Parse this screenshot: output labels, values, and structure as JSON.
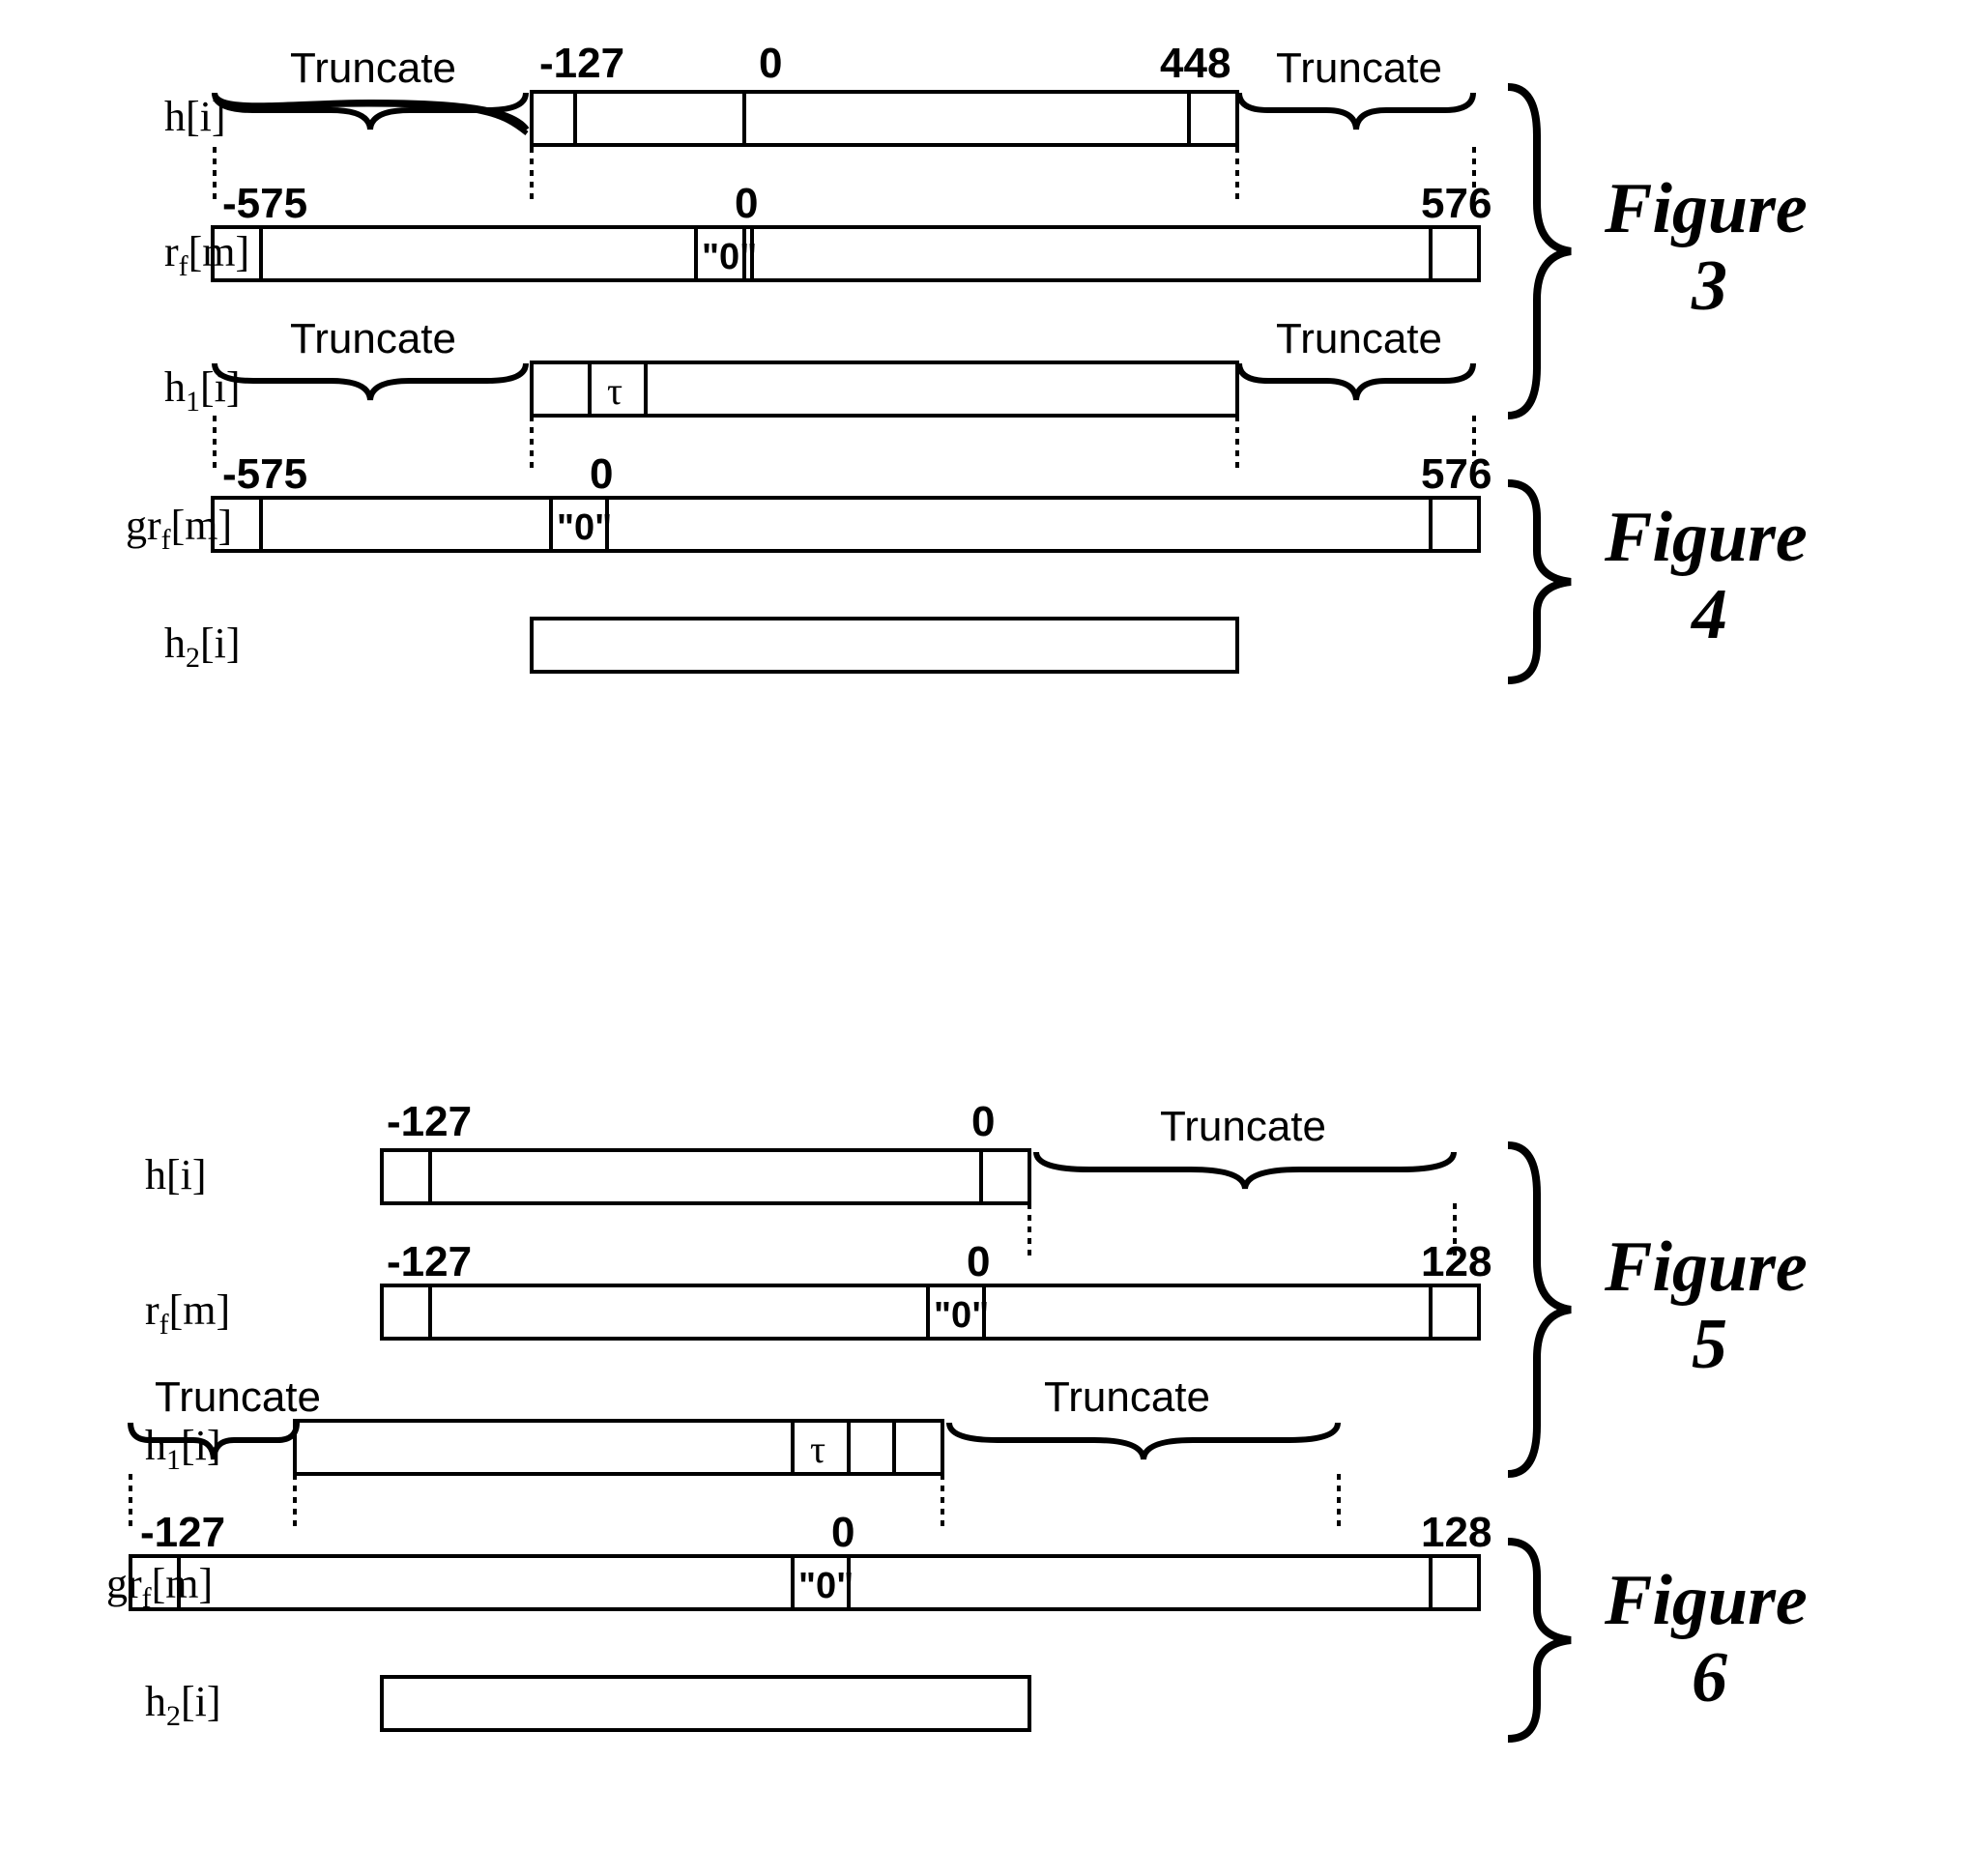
{
  "fig3": {
    "label": "Figure 3",
    "rows": {
      "h": {
        "name": "h[i]",
        "ticks": {
          "start": "-127",
          "zero": "0",
          "end": "448"
        },
        "truncLeft": "Truncate",
        "truncRight": "Truncate"
      },
      "rf": {
        "name": "r",
        "sub": "f",
        "arg": "[m]",
        "ticks": {
          "start": "-575",
          "zero": "0",
          "end": "576"
        },
        "zeroCell": "\"0\""
      },
      "h1": {
        "name": "h",
        "sub": "1",
        "arg": "[i]",
        "tau": "τ",
        "truncLeft": "Truncate",
        "truncRight": "Truncate"
      }
    }
  },
  "fig4": {
    "label": "Figure 4",
    "rows": {
      "grf": {
        "name": "gr",
        "sub": "f",
        "arg": "[m]",
        "ticks": {
          "start": "-575",
          "zero": "0",
          "end": "576"
        },
        "zeroCell": "\"0\""
      },
      "h2": {
        "name": "h",
        "sub": "2",
        "arg": "[i]"
      }
    }
  },
  "fig5": {
    "label": "Figure 5",
    "rows": {
      "h": {
        "name": "h[i]",
        "ticks": {
          "start": "-127",
          "zero": "0"
        },
        "truncRight": "Truncate"
      },
      "rf": {
        "name": "r",
        "sub": "f",
        "arg": "[m]",
        "ticks": {
          "start": "-127",
          "zero": "0",
          "end": "128"
        },
        "zeroCell": "\"0\""
      },
      "h1": {
        "name": "h",
        "sub": "1",
        "arg": "[i]",
        "tau": "τ",
        "truncLeft": "Truncate",
        "truncRight": "Truncate"
      }
    }
  },
  "fig6": {
    "label": "Figure 6",
    "rows": {
      "grf": {
        "name": "gr",
        "sub": "f",
        "arg": "[m]",
        "ticks": {
          "start": "-127",
          "zero": "0",
          "end": "128"
        },
        "zeroCell": "\"0\""
      },
      "h2": {
        "name": "h",
        "sub": "2",
        "arg": "[i]"
      }
    }
  },
  "chart_data": [
    {
      "type": "bar",
      "figure": "3",
      "series": "h[i]",
      "range": [
        -127,
        448
      ],
      "zero_marker": 0,
      "truncated": [
        "left",
        "right"
      ]
    },
    {
      "type": "bar",
      "figure": "3",
      "series": "r_f[m]",
      "range": [
        -575,
        576
      ],
      "zero_marker": 0,
      "center_value": "0"
    },
    {
      "type": "bar",
      "figure": "3",
      "series": "h_1[i]",
      "range": [
        -127,
        448
      ],
      "center_value": "τ",
      "truncated": [
        "left",
        "right"
      ]
    },
    {
      "type": "bar",
      "figure": "4",
      "series": "gr_f[m]",
      "range": [
        -575,
        576
      ],
      "zero_marker": 0,
      "center_value": "0"
    },
    {
      "type": "bar",
      "figure": "4",
      "series": "h_2[i]",
      "range": [
        -127,
        448
      ]
    },
    {
      "type": "bar",
      "figure": "5",
      "series": "h[i]",
      "range": [
        -127,
        0
      ],
      "zero_marker": 0,
      "truncated": [
        "right"
      ]
    },
    {
      "type": "bar",
      "figure": "5",
      "series": "r_f[m]",
      "range": [
        -127,
        128
      ],
      "zero_marker": 0,
      "center_value": "0"
    },
    {
      "type": "bar",
      "figure": "5",
      "series": "h_1[i]",
      "range": [
        -127,
        0
      ],
      "center_value": "τ",
      "truncated": [
        "left",
        "right"
      ]
    },
    {
      "type": "bar",
      "figure": "6",
      "series": "gr_f[m]",
      "range": [
        -127,
        128
      ],
      "zero_marker": 0,
      "center_value": "0"
    },
    {
      "type": "bar",
      "figure": "6",
      "series": "h_2[i]",
      "range": [
        -127,
        0
      ]
    }
  ]
}
